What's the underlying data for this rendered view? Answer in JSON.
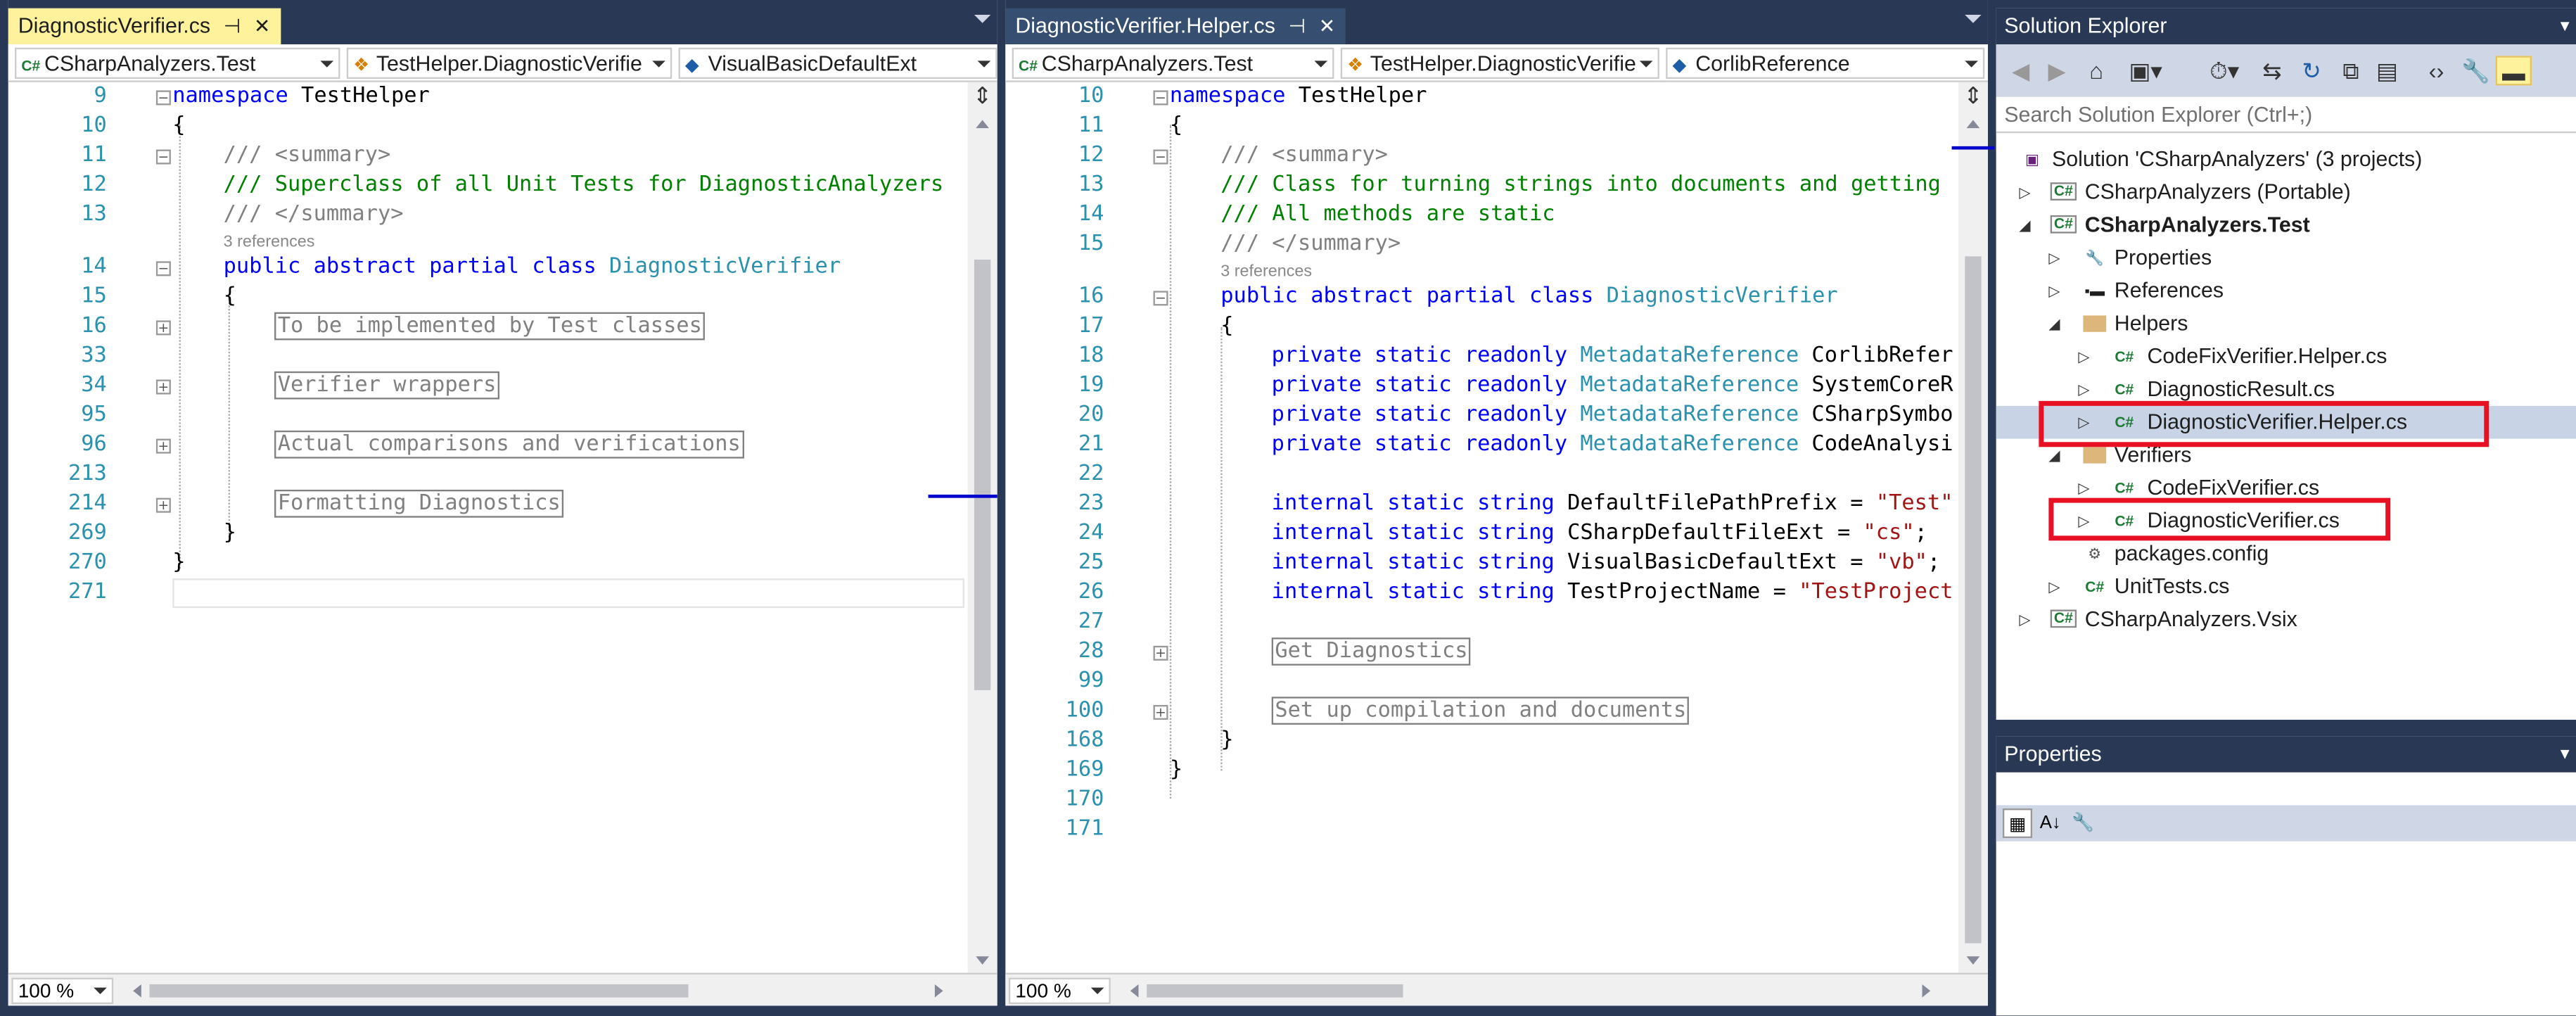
{
  "left_editor": {
    "tab_title": "DiagnosticVerifier.cs",
    "project_combo": "CSharpAnalyzers.Test",
    "type_combo": "TestHelper.DiagnosticVerifie",
    "member_combo": "VisualBasicDefaultExt",
    "zoom": "100 %",
    "refs_text": "3 references",
    "line_numbers": [
      "9",
      "10",
      "11",
      "12",
      "13",
      "14",
      "15",
      "16",
      "33",
      "34",
      "95",
      "96",
      "213",
      "214",
      "269",
      "270",
      "271"
    ],
    "lines": {
      "l9_kw": "namespace",
      "l9_name": " TestHelper",
      "l10": "{",
      "l11_a": "/// ",
      "l11_b": "<summary>",
      "l12": "/// Superclass of all Unit Tests for DiagnosticAnalyzers",
      "l13_a": "/// ",
      "l13_b": "</summary>",
      "l14_kw": "public abstract partial class ",
      "l14_ty": "DiagnosticVerifier",
      "l15": "{",
      "l16": "To be implemented by Test classes",
      "l34": "Verifier wrappers",
      "l96": "Actual comparisons and verifications",
      "l214": "Formatting Diagnostics",
      "l269": "}",
      "l270": "}"
    }
  },
  "right_editor": {
    "tab_title": "DiagnosticVerifier.Helper.cs",
    "project_combo": "CSharpAnalyzers.Test",
    "type_combo": "TestHelper.DiagnosticVerifie",
    "member_combo": "CorlibReference",
    "zoom": "100 %",
    "refs_text": "3 references",
    "line_numbers": [
      "10",
      "11",
      "12",
      "13",
      "14",
      "15",
      "16",
      "17",
      "18",
      "19",
      "20",
      "21",
      "22",
      "23",
      "24",
      "25",
      "26",
      "27",
      "28",
      "99",
      "100",
      "168",
      "169",
      "170",
      "171"
    ],
    "lines": {
      "l10_kw": "namespace",
      "l10_name": " TestHelper",
      "l11": "{",
      "l12_a": "/// ",
      "l12_b": "<summary>",
      "l13": "/// Class for turning strings into documents and getting",
      "l14": "/// All methods are static",
      "l15_a": "/// ",
      "l15_b": "</summary>",
      "l16_kw": "public abstract partial class ",
      "l16_ty": "DiagnosticVerifier",
      "l17": "{",
      "mod": "private static readonly ",
      "mdref": "MetadataReference",
      "l18_name": " CorlibRefer",
      "l19_name": " SystemCoreR",
      "l20_name": " CSharpSymbo",
      "l21_name": " CodeAnalysi",
      "int_kw": "internal static string",
      "l23_name": " DefaultFilePathPrefix = ",
      "l23_str": "\"Test\"",
      "l24_name": " CSharpDefaultFileExt = ",
      "l24_str": "\"cs\"",
      "l24_end": ";",
      "l25_name": " VisualBasicDefaultExt = ",
      "l25_str": "\"vb\"",
      "l25_end": ";",
      "l26_name": " TestProjectName = ",
      "l26_str": "\"TestProject",
      "l28": "Get Diagnostics",
      "l100": "Set up compilation and documents",
      "l168": "}",
      "l169": "}"
    }
  },
  "solution_explorer": {
    "title": "Solution Explorer",
    "search_placeholder": "Search Solution Explorer (Ctrl+;)",
    "items": [
      {
        "label": "Solution 'CSharpAnalyzers' (3 projects)"
      },
      {
        "label": "CSharpAnalyzers (Portable)"
      },
      {
        "label": "CSharpAnalyzers.Test"
      },
      {
        "label": "Properties"
      },
      {
        "label": "References"
      },
      {
        "label": "Helpers"
      },
      {
        "label": "CodeFixVerifier.Helper.cs"
      },
      {
        "label": "DiagnosticResult.cs"
      },
      {
        "label": "DiagnosticVerifier.Helper.cs"
      },
      {
        "label": "Verifiers"
      },
      {
        "label": "CodeFixVerifier.cs"
      },
      {
        "label": "DiagnosticVerifier.cs"
      },
      {
        "label": "packages.config"
      },
      {
        "label": "UnitTests.cs"
      },
      {
        "label": "CSharpAnalyzers.Vsix"
      }
    ],
    "cs_glyph": "C#"
  },
  "properties_panel": {
    "title": "Properties"
  },
  "colors": {
    "highlight_box": "#e81123",
    "active_tab": "#fff29d",
    "chrome": "#293955",
    "selection": "#c9d3e6"
  }
}
